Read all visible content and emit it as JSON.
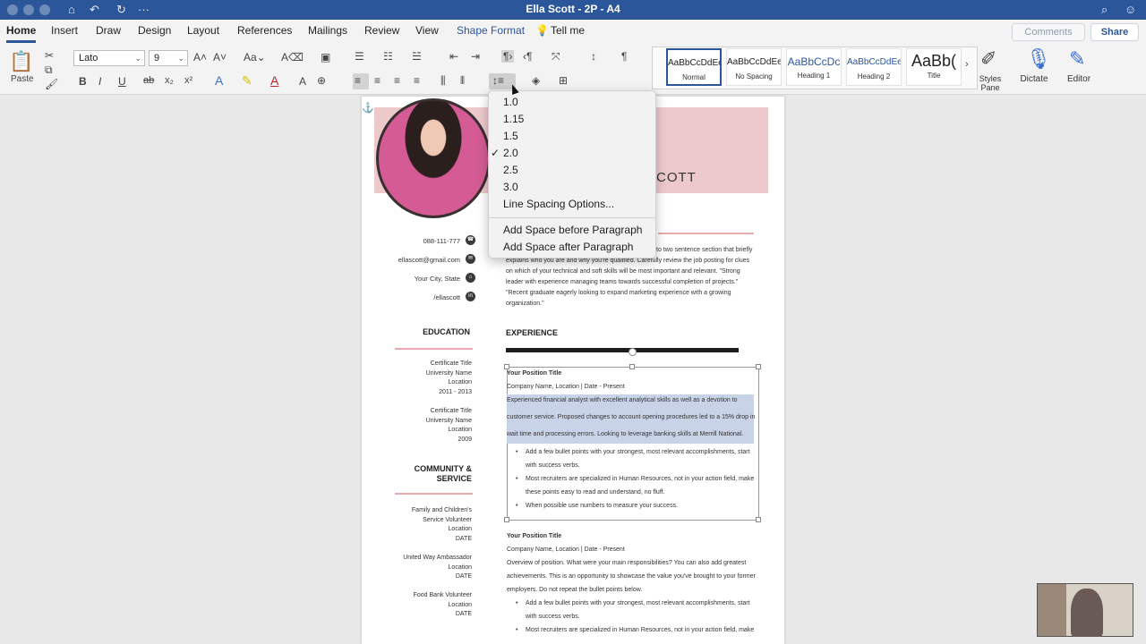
{
  "window": {
    "title": "Ella Scott - 2P - A4"
  },
  "tabs": [
    "Home",
    "Insert",
    "Draw",
    "Design",
    "Layout",
    "References",
    "Mailings",
    "Review",
    "View",
    "Shape Format",
    "Tell me"
  ],
  "header_buttons": {
    "comments": "Comments",
    "share": "Share"
  },
  "ribbon": {
    "paste_label": "Paste",
    "font_name": "Lato",
    "font_size": "9",
    "styles": [
      {
        "preview": "AaBbCcDdEe",
        "name": "Normal"
      },
      {
        "preview": "AaBbCcDdEe",
        "name": "No Spacing"
      },
      {
        "preview": "AaBbCcDc",
        "name": "Heading 1"
      },
      {
        "preview": "AaBbCcDdEe",
        "name": "Heading 2"
      },
      {
        "preview": "AaBb(",
        "name": "Title"
      }
    ],
    "styles_pane_label": "Styles Pane",
    "dictate_label": "Dictate",
    "editor_label": "Editor",
    "format_buttons": [
      "B",
      "I",
      "U",
      "ab",
      "x₂",
      "x²"
    ]
  },
  "line_spacing_menu": {
    "options": [
      "1.0",
      "1.15",
      "1.5",
      "2.0",
      "2.5",
      "3.0"
    ],
    "checked": "2.0",
    "more": "Line Spacing Options...",
    "add_before": "Add Space before Paragraph",
    "add_after": "Add Space after Paragraph"
  },
  "resume": {
    "name_partial": "COTT",
    "contact": [
      "088-111-777",
      "ellascott@gmail.com",
      "Your City, State",
      "/ellascott"
    ],
    "education_heading": "EDUCATION",
    "education": [
      [
        "Certificate Title",
        "University Name",
        "Location",
        "2011 - 2013"
      ],
      [
        "Certificate Title",
        "University Name",
        "Location",
        "2009"
      ]
    ],
    "community_heading_1": "COMMUNITY &",
    "community_heading_2": "SERVICE",
    "community": [
      [
        "Family and Children's",
        "Service Volunteer",
        "Location",
        "DATE"
      ],
      [
        "United Way Ambassador",
        "Location",
        "DATE"
      ],
      [
        "Food Bank Volunteer",
        "Location",
        "DATE"
      ]
    ],
    "summary_lines": [
      "to two sentence section that briefly",
      "explains who you are and why you're qualified. Carefully review the job posting for clues",
      "on which of your technical and soft skills will be most important and relevant. \"Strong",
      "leader with experience managing teams towards successful completion of projects.\"",
      "\"Recent graduate eagerly looking to expand marketing experience with a growing",
      "organization.\""
    ],
    "experience_heading": "EXPERIENCE",
    "job1": {
      "title": "Your Position Title",
      "company": "Company Name, Location | Date - Present",
      "desc": [
        "Experienced financial analyst with excellent analytical skills as well as a devotion to",
        "customer service. Proposed changes to account opening procedures led to a 15% drop in",
        "wait time and processing errors. Looking to leverage banking skills at Merrill National."
      ],
      "bullets": [
        "Add a few bullet points with your strongest, most relevant accomplishments, start",
        "with success verbs.",
        "Most recruiters are specialized in Human Resources, not in your action field, make",
        "these points easy to read and understand, no fluff.",
        "When possible use numbers to measure your success."
      ]
    },
    "job2": {
      "title": "Your Position Title",
      "company": "Company Name, Location | Date - Present",
      "desc": [
        "Overview of position. What were your main responsibilities? You can also add greatest",
        "achievements. This is an opportunity to showcase the value you've brought to your former",
        "employers. Do not repeat the bullet points below."
      ],
      "bullets": [
        "Add a few bullet points with your strongest, most relevant accomplishments, start",
        "with success verbs.",
        "Most recruiters are specialized in Human Resources, not in your action field, make"
      ]
    }
  }
}
